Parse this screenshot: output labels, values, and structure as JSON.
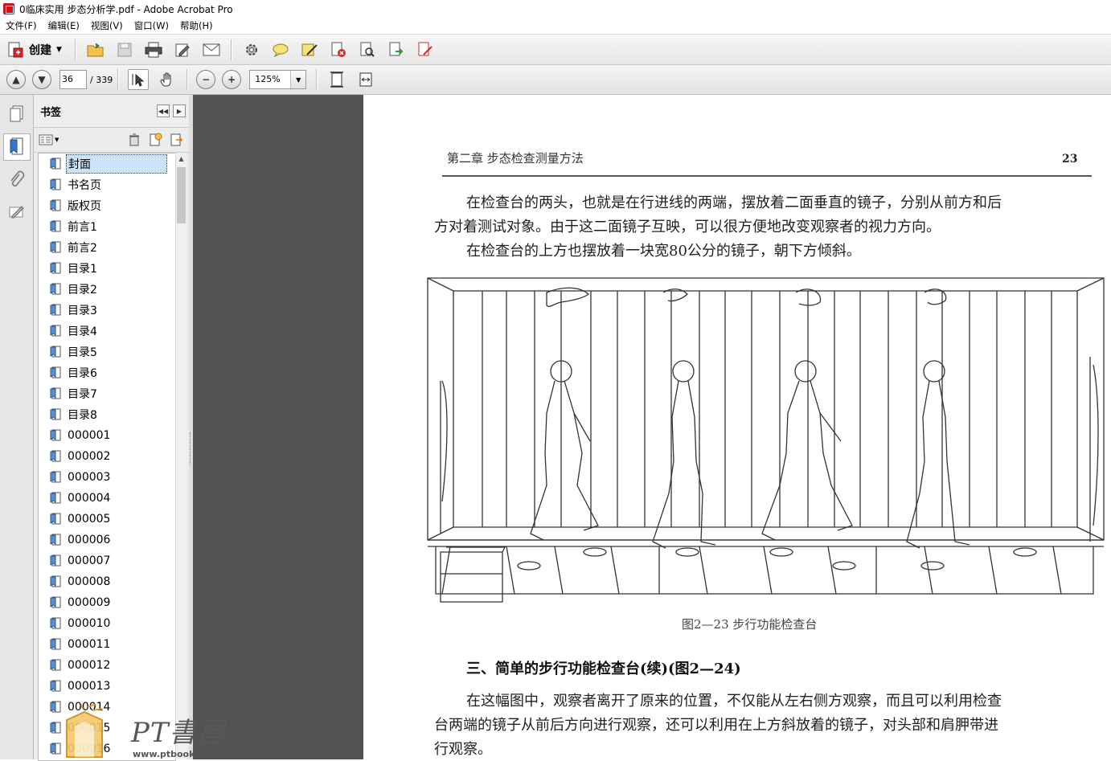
{
  "window": {
    "title": "0临床实用  步态分析学.pdf - Adobe Acrobat Pro"
  },
  "menu": [
    "文件(F)",
    "编辑(E)",
    "视图(V)",
    "窗口(W)",
    "帮助(H)"
  ],
  "toolbar": {
    "create_label": "创建"
  },
  "nav": {
    "current_page": "36",
    "total_pages": "/ 339",
    "zoom": "125%"
  },
  "bookmarks": {
    "header": "书签",
    "items": [
      "封面",
      "书名页",
      "版权页",
      "前言1",
      "前言2",
      "目录1",
      "目录2",
      "目录3",
      "目录4",
      "目录5",
      "目录6",
      "目录7",
      "目录8",
      "000001",
      "000002",
      "000003",
      "000004",
      "000005",
      "000006",
      "000007",
      "000008",
      "000009",
      "000010",
      "000011",
      "000012",
      "000013",
      "000014",
      "000015",
      "000016"
    ],
    "selected_index": 0
  },
  "document": {
    "running_head": "第二章   步态检查测量方法",
    "page_number": "23",
    "paragraphs": [
      "在检查台的两头，也就是在行进线的两端，摆放着二面垂直的镜子，分别从前方和后",
      "方对着测试对象。由于这二面镜子互映，可以很方便地改变观察者的视力方向。",
      "在检查台的上方也摆放着一块宽80公分的镜子，朝下方倾斜。"
    ],
    "figure_caption": "图2—23   步行功能检查台",
    "section_heading": "三、简单的步行功能检查台(续)(图2—24)",
    "paragraphs2": [
      "在这幅图中，观察者离开了原来的位置，不仅能从左右侧方观察，而且可以利用检查",
      "台两端的镜子从前后方向进行观察，还可以利用在上方斜放着的镜子，对头部和肩胛带进",
      "行观察。"
    ]
  },
  "watermark": {
    "text": "PT書屋",
    "url": "www.ptbook.cn"
  }
}
